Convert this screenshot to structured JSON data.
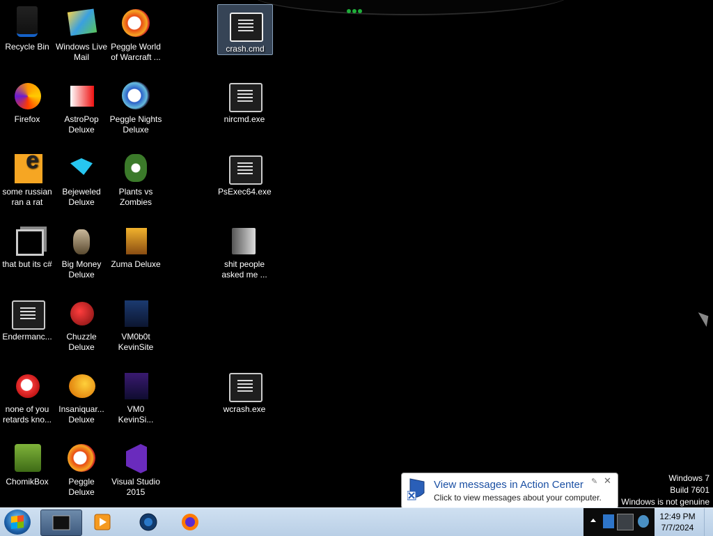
{
  "desktop": {
    "icons": [
      {
        "label": "Recycle Bin",
        "icon": "recycle-bin-icon"
      },
      {
        "label": "Windows Live Mail",
        "icon": "windows-live-mail-icon"
      },
      {
        "label": "Peggle World of Warcraft ...",
        "icon": "peggle-icon"
      },
      {
        "label": "crash.cmd",
        "icon": "cmd-file-icon"
      },
      {
        "label": "Firefox",
        "icon": "firefox-icon"
      },
      {
        "label": "AstroPop Deluxe",
        "icon": "astropop-icon"
      },
      {
        "label": "Peggle Nights Deluxe",
        "icon": "peggle-nights-icon"
      },
      {
        "label": "nircmd.exe",
        "icon": "exe-icon"
      },
      {
        "label": "some russian ran a rat",
        "icon": "rat-icon"
      },
      {
        "label": "Bejeweled Deluxe",
        "icon": "bejeweled-icon"
      },
      {
        "label": "Plants vs Zombies",
        "icon": "plants-vs-zombies-icon"
      },
      {
        "label": "PsExec64.exe",
        "icon": "exe-icon"
      },
      {
        "label": "that but its c#",
        "icon": "stack-icon"
      },
      {
        "label": "Big Money Deluxe",
        "icon": "big-money-icon"
      },
      {
        "label": "Zuma Deluxe",
        "icon": "zuma-icon"
      },
      {
        "label": "shit people asked me ...",
        "icon": "folder-icon"
      },
      {
        "label": "Endermanc...",
        "icon": "exe-icon"
      },
      {
        "label": "Chuzzle Deluxe",
        "icon": "chuzzle-icon"
      },
      {
        "label": "VM0b0t KevinSite",
        "icon": "vm-icon"
      },
      {
        "label": "none of you retards kno...",
        "icon": "chrome-like-icon"
      },
      {
        "label": "Insaniquar... Deluxe",
        "icon": "insaniquarium-icon"
      },
      {
        "label": "VM0 KevinSi...",
        "icon": "vm-icon"
      },
      {
        "label": "wcrash.exe",
        "icon": "exe-icon"
      },
      {
        "label": "ChomikBox",
        "icon": "chomikbox-icon"
      },
      {
        "label": "Peggle Deluxe",
        "icon": "peggle-icon"
      },
      {
        "label": "Visual Studio 2015",
        "icon": "visual-studio-icon"
      }
    ]
  },
  "watermark": {
    "line1": "Windows 7",
    "line2": "Build 7601",
    "line3": "Windows is not genuine"
  },
  "balloon": {
    "title": "View messages in Action Center",
    "subtitle": "Click to view messages about your computer.",
    "close": "✕",
    "pin": "✎"
  },
  "taskbar": {
    "buttons": [
      {
        "icon": "cmd-window-icon",
        "active": true
      },
      {
        "icon": "media-player-icon",
        "active": false
      },
      {
        "icon": "media-center-icon",
        "active": false
      },
      {
        "icon": "firefox-icon",
        "active": false
      }
    ],
    "clock": {
      "time": "12:49 PM",
      "date": "7/7/2024"
    }
  },
  "colors": {
    "desktop": "#000000",
    "taskbar": "#c3d7ec",
    "link": "#1a4fa3"
  }
}
